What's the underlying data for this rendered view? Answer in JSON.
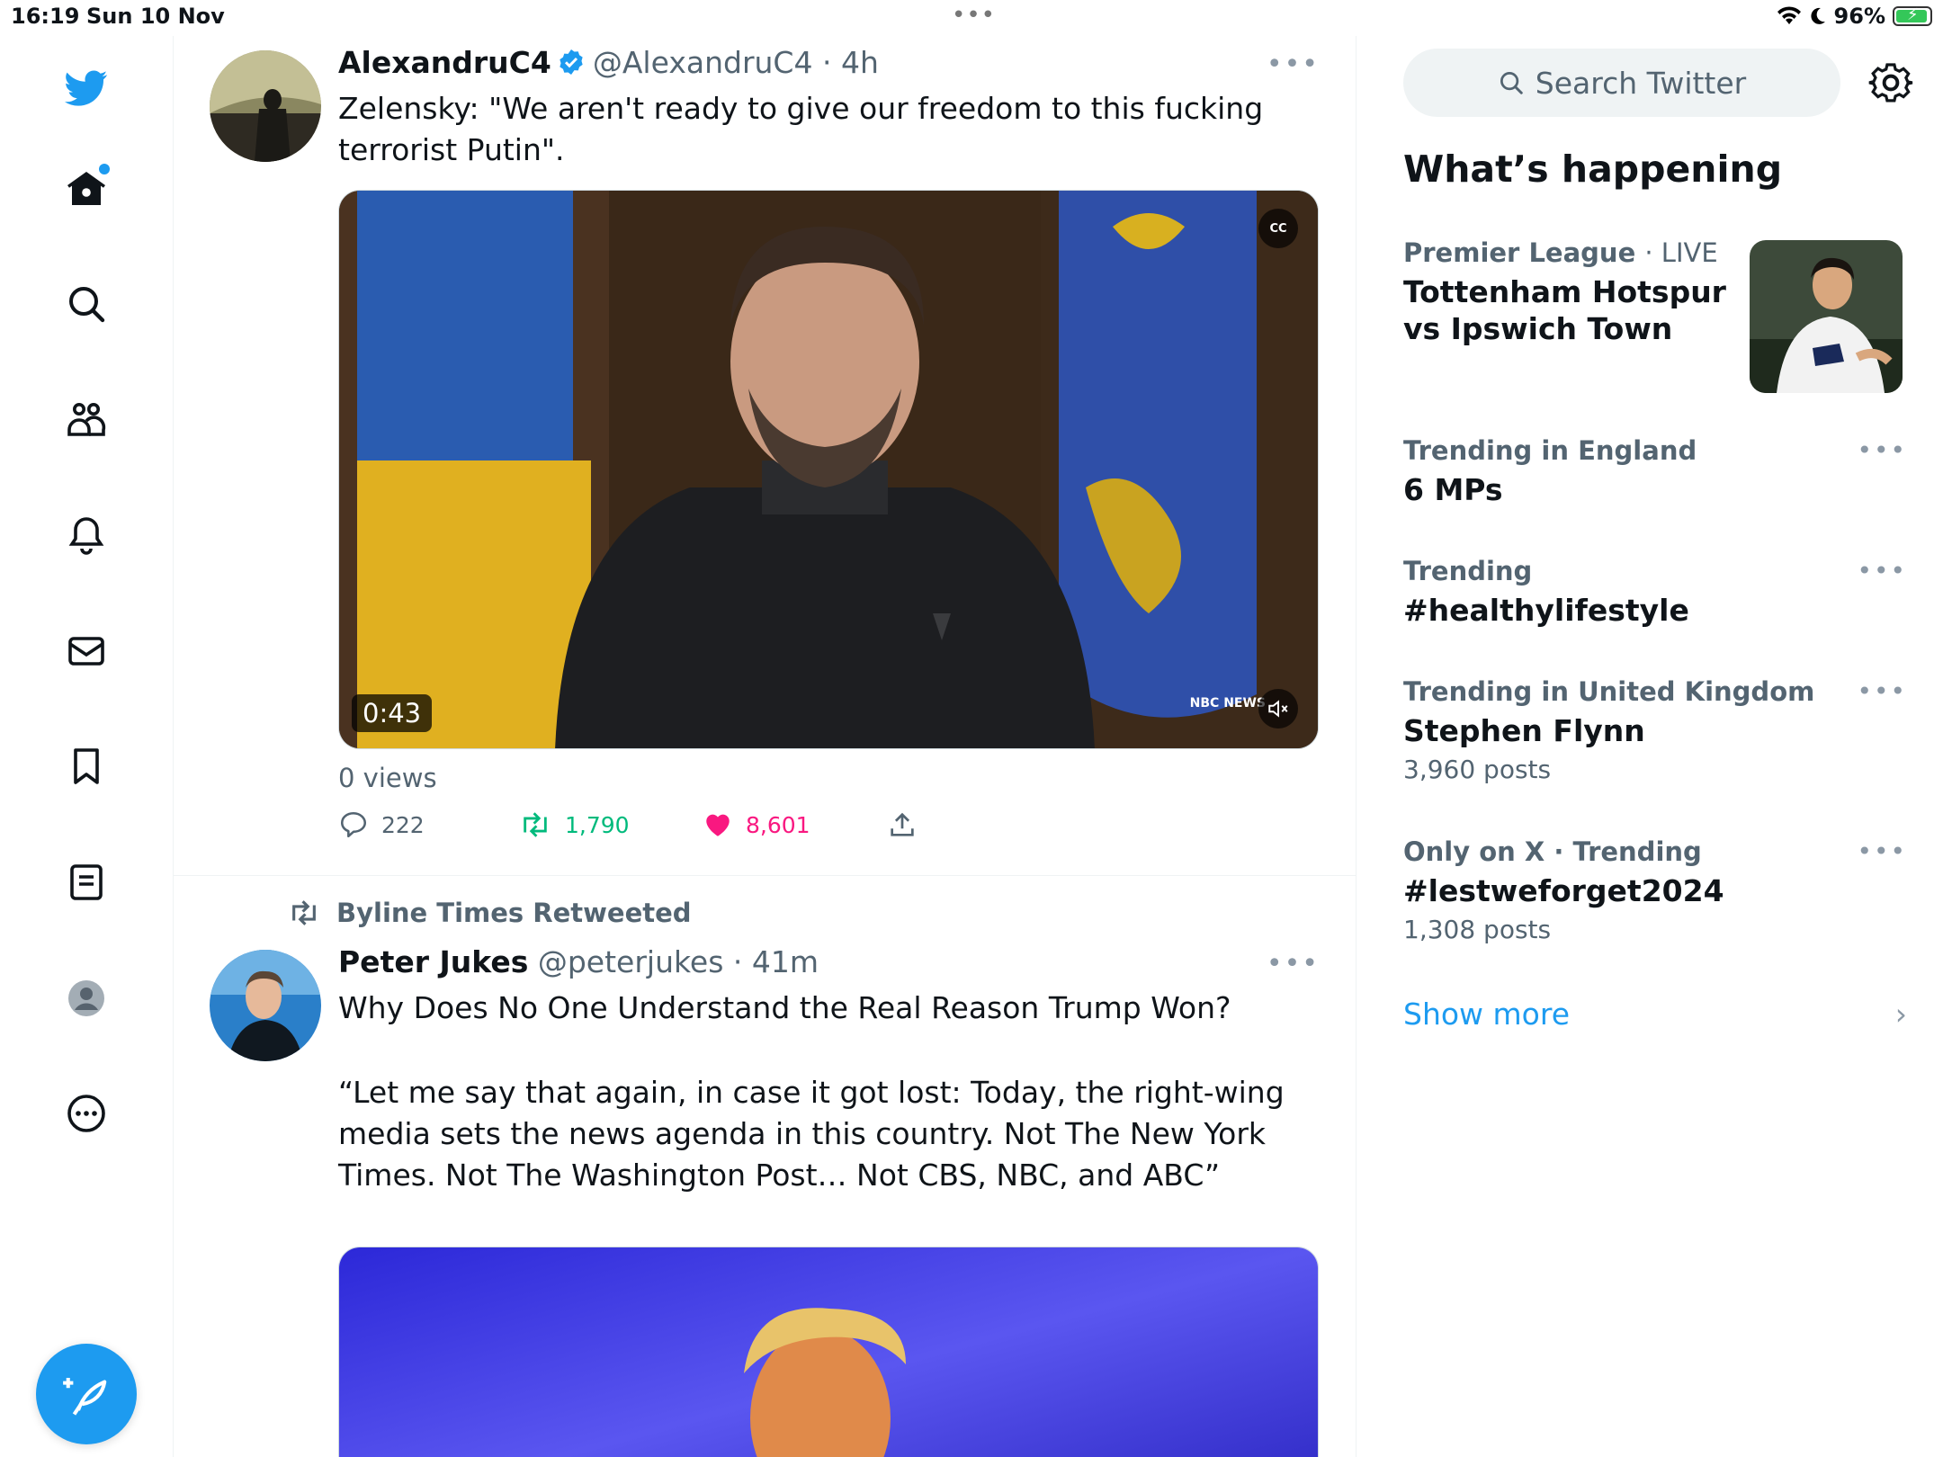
{
  "status_bar": {
    "time": "16:19",
    "date": "Sun 10 Nov",
    "battery": "96%"
  },
  "nav": {
    "items": [
      "home-icon",
      "search-icon",
      "communities-icon",
      "bell-icon",
      "mail-icon",
      "bookmark-icon",
      "lists-icon",
      "profile-icon",
      "more-icon"
    ],
    "compose_icon": "compose-icon",
    "home_unread": true
  },
  "feed": {
    "tweets": [
      {
        "name": "AlexandruC4",
        "handle": "@AlexandruC4",
        "time": "· 4h",
        "verified": true,
        "text": "Zelensky: \"We aren't ready to give our freedom to this fucking terrorist Putin\".",
        "video": {
          "duration": "0:43",
          "cc": "CC",
          "channel": "NBC NEWS"
        },
        "views": "0 views",
        "replies": "222",
        "retweets": "1,790",
        "likes": "8,601"
      },
      {
        "retweeted_by": "Byline Times Retweeted",
        "name": "Peter Jukes",
        "handle": "@peterjukes",
        "time": "· 41m",
        "text_line1": "Why Does No One Understand the Real Reason Trump Won?",
        "text_quote": "“Let me say that again, in case it got lost: Today, the right-wing media sets the news agenda in this country. Not The New York Times. Not The Washington Post… Not CBS, NBC, and ABC”"
      }
    ]
  },
  "sidebar": {
    "search_placeholder": "Search Twitter",
    "whats_happening": "What’s happening",
    "trends": [
      {
        "meta": "Premier League",
        "meta_extra": "· LIVE",
        "title": "Tottenham Hotspur vs Ipswich Town"
      },
      {
        "meta": "Trending in England",
        "title": "6 MPs"
      },
      {
        "meta": "Trending",
        "title": "#healthylifestyle"
      },
      {
        "meta": "Trending in United Kingdom",
        "title": "Stephen Flynn",
        "count": "3,960 posts"
      },
      {
        "meta": "Only on X · Trending",
        "title": "#lestweforget2024",
        "count": "1,308 posts"
      }
    ],
    "show_more": "Show more"
  },
  "colors": {
    "accent": "#1d9bf0",
    "retweet": "#00ba7c",
    "like": "#f91880",
    "secondary": "#536471"
  }
}
